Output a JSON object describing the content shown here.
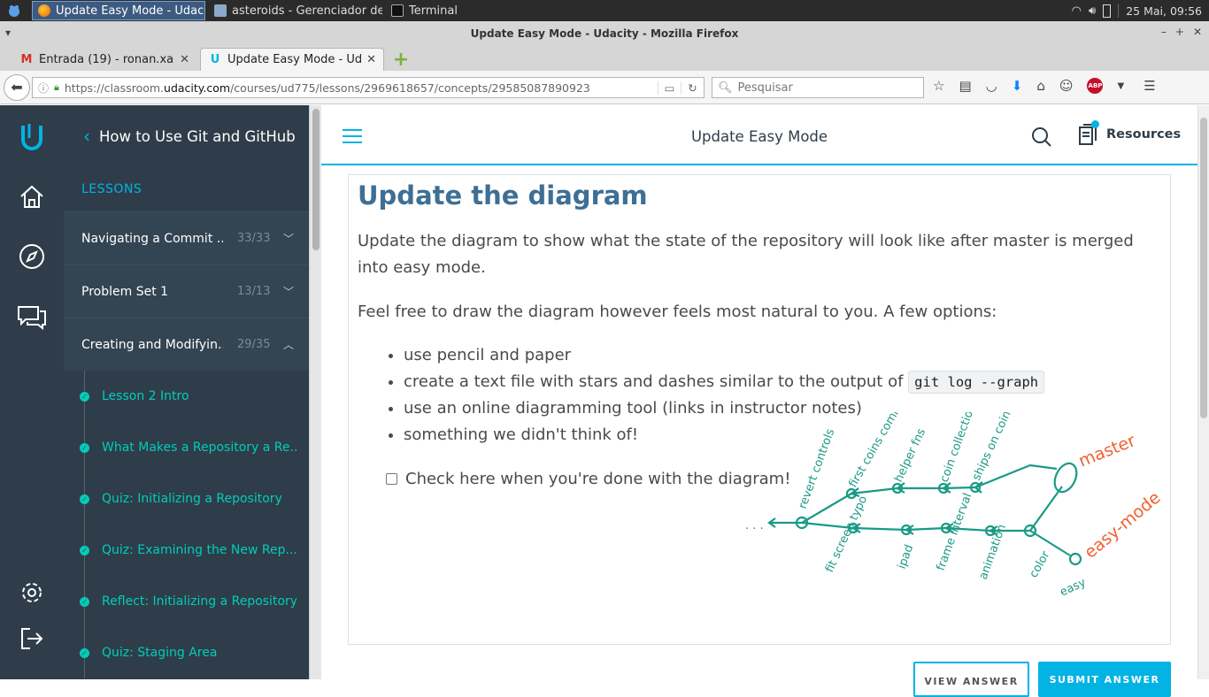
{
  "taskbar": {
    "items": [
      {
        "label": "Update Easy Mode - Udaci...",
        "active": true,
        "icon": "firefox-icon"
      },
      {
        "label": "asteroids - Gerenciador de ...",
        "active": false,
        "icon": "folder-icon"
      },
      {
        "label": "Terminal",
        "active": false,
        "icon": "terminal-icon"
      }
    ],
    "datetime": "25 Mai, 09:56"
  },
  "browser": {
    "window_title": "Update Easy Mode - Udacity - Mozilla Firefox",
    "tabs": [
      {
        "label": "Entrada (19) - ronan.xa...",
        "icon": "gmail-icon",
        "active": false
      },
      {
        "label": "Update Easy Mode - Ud...",
        "icon": "udacity-icon",
        "active": true
      }
    ],
    "url_host_prefix": "https://classroom.",
    "url_host": "udacity.com",
    "url_path": "/courses/ud775/lessons/2969618657/concepts/29585087890923",
    "search_placeholder": "Pesquisar"
  },
  "sidebar": {
    "course_title": "How to Use Git and GitHub",
    "lessons_label": "LESSONS",
    "lessons": [
      {
        "name": "Navigating a Commit ...",
        "count": "33/33",
        "expanded": false
      },
      {
        "name": "Problem Set 1",
        "count": "13/13",
        "expanded": false
      },
      {
        "name": "Creating and Modifyin...",
        "count": "29/35",
        "expanded": true
      }
    ],
    "concepts": [
      "Lesson 2 Intro",
      "What Makes a Repository a Re...",
      "Quiz: Initializing a Repository",
      "Quiz: Examining the New Rep...",
      "Reflect: Initializing a Repository",
      "Quiz: Staging Area"
    ]
  },
  "header": {
    "title": "Update Easy Mode",
    "resources_label": "Resources"
  },
  "content": {
    "heading": "Update the diagram",
    "paragraph1": "Update the diagram to show what the state of the repository will look like after master is merged into easy mode.",
    "paragraph2": "Feel free to draw the diagram however feels most natural to you. A few options:",
    "options": [
      {
        "text": "use pencil and paper",
        "code": ""
      },
      {
        "text": "create a text file with stars and dashes similar to the output of ",
        "code": "git log --graph"
      },
      {
        "text": "use an online diagramming tool (links in instructor notes)",
        "code": ""
      },
      {
        "text": "something we didn't think of!",
        "code": ""
      }
    ],
    "checkbox_label": "Check here when you're done with the diagram!",
    "checkbox_checked": false,
    "diagram_labels": {
      "master": "master",
      "easy_mode": "easy-mode",
      "commits_top": [
        "revert controls",
        "first coins commit",
        "helper fns",
        "coin collection",
        "ships on coins"
      ],
      "commits_bottom": [
        "fit screen typo",
        "ipad",
        "frame interval",
        "animation",
        "color",
        "easy"
      ],
      "ellipsis": ". . ."
    }
  },
  "footer": {
    "view_answer": "VIEW ANSWER",
    "submit_answer": "SUBMIT ANSWER"
  },
  "colors": {
    "accent": "#02b3e4",
    "sidebar_bg": "#2e3d49",
    "concept_teal": "#02ccba",
    "heading_blue": "#3e6f95",
    "diagram_green": "#1a9a86",
    "diagram_orange": "#f0612f"
  }
}
